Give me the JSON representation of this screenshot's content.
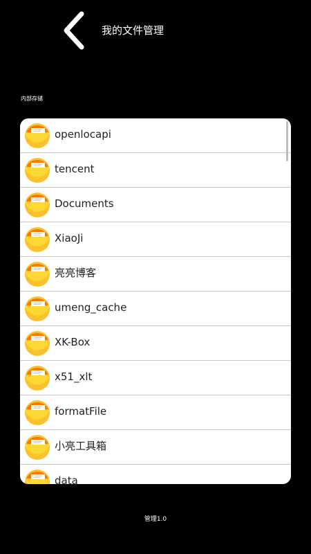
{
  "header": {
    "title": "我的文件管理",
    "back_icon": "chevron-left-icon"
  },
  "section": {
    "label": "内部存储"
  },
  "files": [
    {
      "name": "openlocapi"
    },
    {
      "name": "tencent"
    },
    {
      "name": "Documents"
    },
    {
      "name": "XiaoJi"
    },
    {
      "name": "亮亮博客"
    },
    {
      "name": "umeng_cache"
    },
    {
      "name": "XK-Box"
    },
    {
      "name": "x51_xlt"
    },
    {
      "name": "formatFile"
    },
    {
      "name": "小亮工具箱"
    },
    {
      "name": "data"
    }
  ],
  "colors": {
    "folder": "#FBC02D",
    "folder_tab": "#F57C00",
    "background": "#000000",
    "card": "#FFFFFF"
  },
  "footer": {
    "text": "管理1.0"
  }
}
